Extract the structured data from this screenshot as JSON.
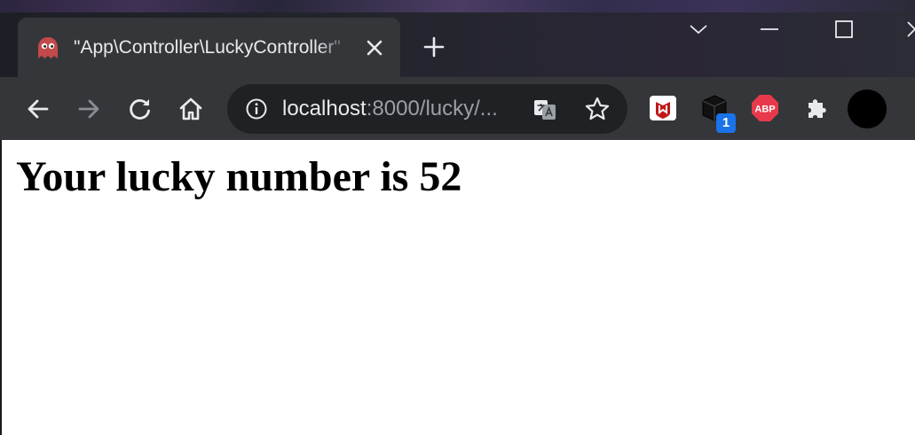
{
  "browser": {
    "tab": {
      "title": "\"App\\Controller\\LuckyController\"",
      "favicon": "ghost-icon",
      "close_icon": "close-icon"
    },
    "new_tab_icon": "plus-icon",
    "window_controls": [
      "chevron-down-icon",
      "minimize-icon",
      "maximize-icon",
      "close-icon"
    ],
    "nav": [
      "back-arrow-icon",
      "forward-arrow-icon",
      "reload-icon",
      "home-icon"
    ],
    "address_bar": {
      "host": "localhost",
      "rest": ":8000/lucky/...",
      "icons": [
        "info-icon",
        "translate-icon",
        "star-icon"
      ]
    },
    "extensions": {
      "icons": [
        "mcafee-icon",
        "extension-box-icon",
        "adblock-plus-icon",
        "puzzle-icon"
      ],
      "badge": "1",
      "abp_text": "ABP"
    },
    "colors": {
      "frame": "#202124",
      "toolbar": "#35363a",
      "badge": "#1a73e8",
      "abp": "#e8394b",
      "mcafee": "#c01818",
      "favicon": "#c24a4a"
    }
  },
  "page": {
    "heading": "Your lucky number is 52"
  }
}
